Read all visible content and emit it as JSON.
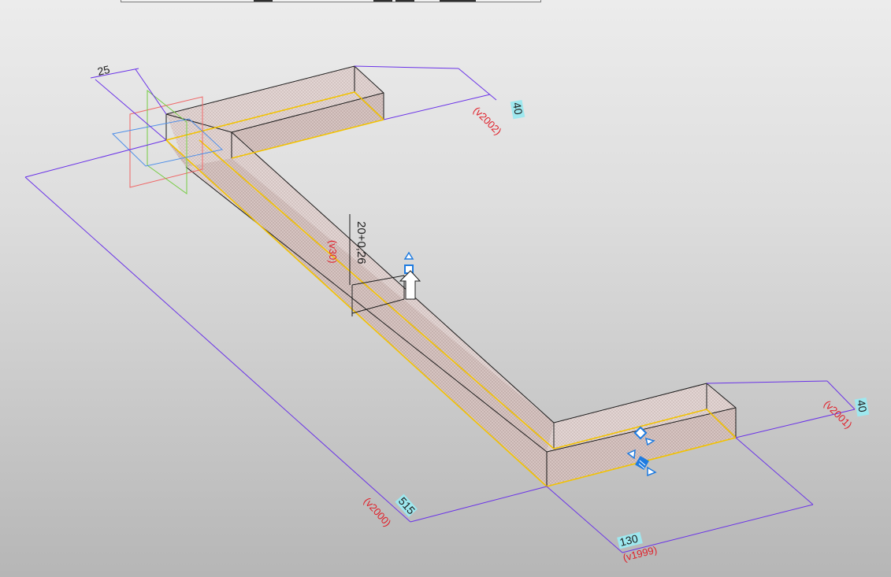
{
  "viewport": {
    "dimensions": {
      "depth_left": "25",
      "wall_right_top": "40",
      "wall_right_bottom": "40",
      "long_edge": "515",
      "bottom_length": "130",
      "center_tolerance": "20+0,26"
    },
    "variables": {
      "v_top_right": "(v2002)",
      "v_bottom_right": "(v2001)",
      "v_long_edge": "(v2000)",
      "v_bottom_length": "(v1999)",
      "v_center": "(v30)"
    }
  },
  "colors": {
    "dimension_line": "#6a32e8",
    "edge_highlight": "#f2c200",
    "variable_text": "#e0202a",
    "handle": "#1e7be0",
    "dim_value_bg": "#9ee8ef",
    "plane_red": "#ef6666",
    "plane_green": "#77cc44",
    "plane_blue": "#4f8fe8"
  }
}
